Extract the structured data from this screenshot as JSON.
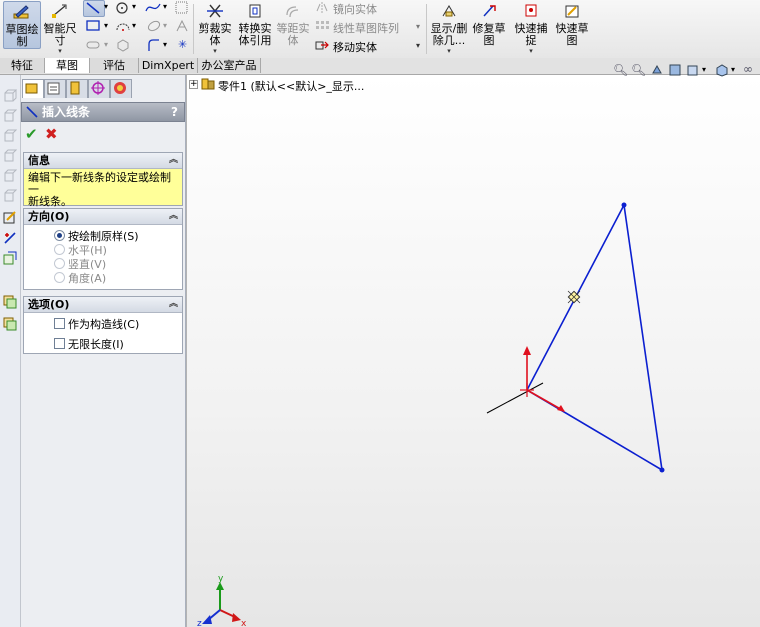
{
  "toolbar": {
    "sketch": "草图绘\n制",
    "smart_dim": "智能尺\n寸",
    "trim": "剪裁实\n体",
    "convert": "转换实\n体引用",
    "offset": "等距实\n体",
    "mirror": "镜向实体",
    "linear_pattern": "线性草图阵列",
    "move": "移动实体",
    "display_delete": "显示/删\n除几...",
    "repair": "修复草\n图",
    "quick_snap": "快速捕\n捉",
    "rapid_sketch": "快速草\n图"
  },
  "tabs": [
    "特征",
    "草图",
    "评估",
    "DimXpert",
    "办公室产品"
  ],
  "active_tab": 1,
  "tree": {
    "root": "零件1 (默认<<默认>_显示..."
  },
  "pm": {
    "title": "插入线条",
    "help": "?",
    "info_header": "信息",
    "info_text_1": "编辑下一新线条的设定或绘制一",
    "info_text_2": "新线条。",
    "orient_header": "方向(O)",
    "orient": [
      {
        "label": "按绘制原样(S)",
        "checked": true,
        "enabled": true
      },
      {
        "label": "水平(H)",
        "checked": false,
        "enabled": false
      },
      {
        "label": "竖直(V)",
        "checked": false,
        "enabled": false
      },
      {
        "label": "角度(A)",
        "checked": false,
        "enabled": false
      }
    ],
    "options_header": "选项(O)",
    "opt_construction": "作为构造线(C)",
    "opt_infinite": "无限长度(I)"
  },
  "colors": {
    "sketch_line": "#0b1fd0",
    "origin": "#e0101e",
    "info_bg": "#ffff99"
  },
  "axes": {
    "x": "x",
    "y": "y",
    "z": "z"
  }
}
